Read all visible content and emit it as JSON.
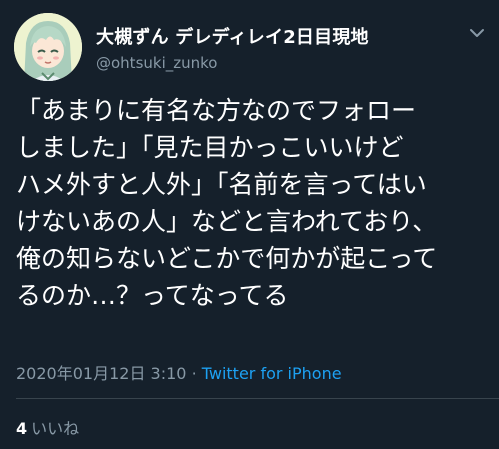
{
  "author": {
    "display_name": "大槻ずん デレディレイ2日目現地",
    "handle": "@ohtsuki_zunko"
  },
  "tweet": {
    "lines": [
      "「あまりに有名な方なのでフォロー",
      "しました」「見た目かっこいいけど",
      "ハメ外すと人外」「名前を言ってはい",
      "けないあの人」などと言われており、",
      "俺の知らないどこかで何かが起こって",
      "るのか…？ってなってる"
    ]
  },
  "meta": {
    "timestamp": "2020年01月12日 3:10",
    "separator": "·",
    "source": "Twitter for iPhone"
  },
  "likes": {
    "count": "4",
    "label": "いいね"
  },
  "colors": {
    "background": "#15202b",
    "text": "#ffffff",
    "muted": "#8899a6",
    "link": "#1da1f2",
    "divider": "#38444d"
  },
  "icons": {
    "menu": "chevron-down-icon",
    "avatar": "avatar"
  }
}
